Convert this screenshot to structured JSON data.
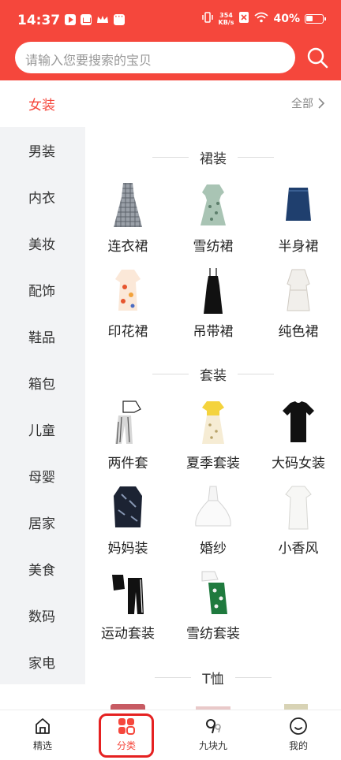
{
  "status": {
    "time": "14:37",
    "net_speed_top": "354",
    "net_speed_bottom": "KB/s",
    "battery": "40%"
  },
  "search": {
    "placeholder": "请输入您要搜索的宝贝"
  },
  "colors": {
    "accent": "#f5473c",
    "highlight": "#e52121"
  },
  "sidebar": {
    "items": [
      {
        "label": "女装"
      },
      {
        "label": "男装"
      },
      {
        "label": "内衣"
      },
      {
        "label": "美妆"
      },
      {
        "label": "配饰"
      },
      {
        "label": "鞋品"
      },
      {
        "label": "箱包"
      },
      {
        "label": "儿童"
      },
      {
        "label": "母婴"
      },
      {
        "label": "居家"
      },
      {
        "label": "美食"
      },
      {
        "label": "数码"
      },
      {
        "label": "家电"
      }
    ]
  },
  "main": {
    "all_label": "全部",
    "sections": [
      {
        "title": "裙装",
        "items": [
          {
            "label": "连衣裙",
            "icon": "plaid-dress-icon"
          },
          {
            "label": "雪纺裙",
            "icon": "floral-dress-icon"
          },
          {
            "label": "半身裙",
            "icon": "denim-skirt-icon"
          },
          {
            "label": "印花裙",
            "icon": "print-dress-icon"
          },
          {
            "label": "吊带裙",
            "icon": "slip-dress-icon"
          },
          {
            "label": "纯色裙",
            "icon": "white-dress-icon"
          }
        ]
      },
      {
        "title": "套装",
        "items": [
          {
            "label": "两件套",
            "icon": "two-piece-icon"
          },
          {
            "label": "夏季套装",
            "icon": "summer-set-icon"
          },
          {
            "label": "大码女装",
            "icon": "plus-size-tee-icon"
          },
          {
            "label": "妈妈装",
            "icon": "mom-wear-icon"
          },
          {
            "label": "婚纱",
            "icon": "wedding-dress-icon"
          },
          {
            "label": "小香风",
            "icon": "chanel-style-icon"
          },
          {
            "label": "运动套装",
            "icon": "sport-set-icon"
          },
          {
            "label": "雪纺套装",
            "icon": "chiffon-set-icon"
          }
        ]
      },
      {
        "title": "T恤"
      }
    ]
  },
  "bottom_nav": {
    "items": [
      {
        "label": "精选",
        "icon": "home-icon"
      },
      {
        "label": "分类",
        "icon": "category-icon"
      },
      {
        "label": "九块九",
        "icon": "nine-nine-icon"
      },
      {
        "label": "我的",
        "icon": "profile-icon"
      }
    ]
  }
}
